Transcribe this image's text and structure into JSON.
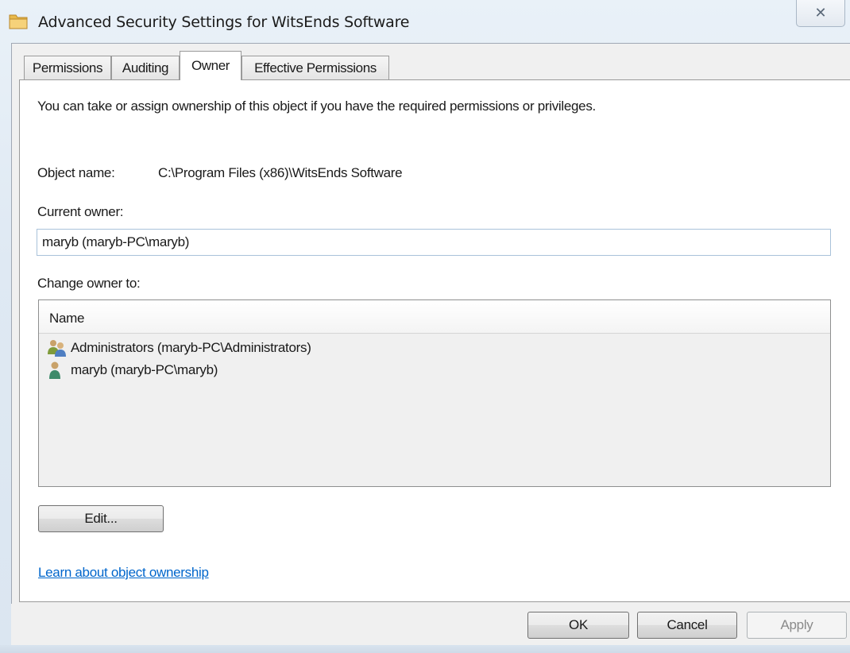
{
  "window": {
    "title": "Advanced Security Settings for WitsEnds Software",
    "close_glyph": "✕"
  },
  "tabs": [
    {
      "label": "Permissions",
      "active": false
    },
    {
      "label": "Auditing",
      "active": false
    },
    {
      "label": "Owner",
      "active": true
    },
    {
      "label": "Effective Permissions",
      "active": false
    }
  ],
  "owner_tab": {
    "description": "You can take or assign ownership of this object if you have the required permissions or privileges.",
    "object_name_label": "Object name:",
    "object_name_value": "C:\\Program Files (x86)\\WitsEnds Software",
    "current_owner_label": "Current owner:",
    "current_owner_value": "maryb (maryb-PC\\maryb)",
    "change_owner_label": "Change owner to:",
    "list_header": "Name",
    "list_items": [
      {
        "label": "Administrators (maryb-PC\\Administrators)",
        "icon": "group-icon"
      },
      {
        "label": "maryb (maryb-PC\\maryb)",
        "icon": "user-icon"
      }
    ],
    "edit_button": "Edit...",
    "learn_link": "Learn about object ownership"
  },
  "footer": {
    "ok_label": "OK",
    "cancel_label": "Cancel",
    "apply_label": "Apply"
  },
  "colors": {
    "link": "#0066cc",
    "panel_bg": "#ffffff",
    "dialog_bg": "#f0f0f0"
  }
}
